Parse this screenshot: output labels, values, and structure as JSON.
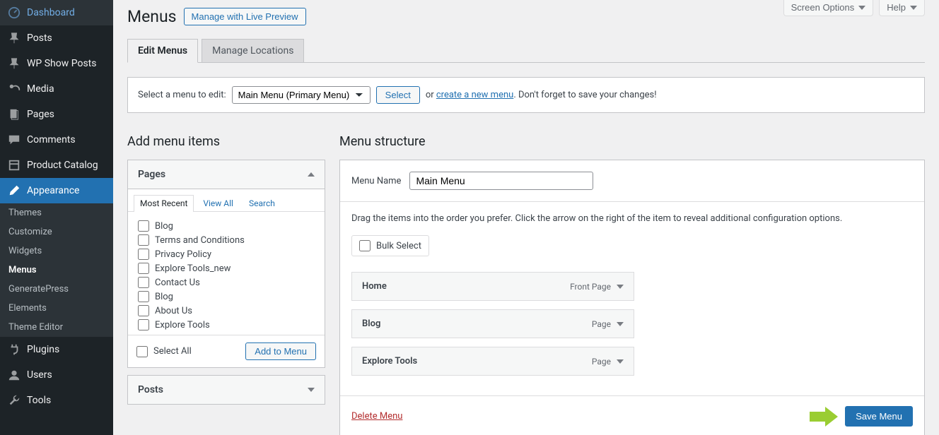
{
  "sidebar": {
    "items": [
      {
        "label": "Dashboard",
        "icon": "dashboard"
      },
      {
        "label": "Posts",
        "icon": "pin"
      },
      {
        "label": "WP Show Posts",
        "icon": "pin"
      },
      {
        "label": "Media",
        "icon": "media"
      },
      {
        "label": "Pages",
        "icon": "pages"
      },
      {
        "label": "Comments",
        "icon": "comment"
      },
      {
        "label": "Product Catalog",
        "icon": "catalog"
      },
      {
        "label": "Appearance",
        "icon": "brush",
        "active": true
      },
      {
        "label": "Plugins",
        "icon": "plugin"
      },
      {
        "label": "Users",
        "icon": "user"
      },
      {
        "label": "Tools",
        "icon": "wrench"
      }
    ],
    "submenu": [
      "Themes",
      "Customize",
      "Widgets",
      "Menus",
      "GeneratePress",
      "Elements",
      "Theme Editor"
    ],
    "submenu_current": "Menus"
  },
  "top": {
    "screen_options": "Screen Options",
    "help": "Help"
  },
  "title": "Menus",
  "live_preview": "Manage with Live Preview",
  "tabs": [
    {
      "label": "Edit Menus",
      "active": true
    },
    {
      "label": "Manage Locations",
      "active": false
    }
  ],
  "select_bar": {
    "label": "Select a menu to edit:",
    "value": "Main Menu (Primary Menu)",
    "btn": "Select",
    "or": "or",
    "link": "create a new menu",
    "tail": ". Don't forget to save your changes!"
  },
  "left": {
    "heading": "Add menu items",
    "accordion_pages": "Pages",
    "sub_tabs": [
      "Most Recent",
      "View All",
      "Search"
    ],
    "pages": [
      "Blog",
      "Terms and Conditions",
      "Privacy Policy",
      "Explore Tools_new",
      "Contact Us",
      "Blog",
      "About Us",
      "Explore Tools"
    ],
    "select_all": "Select All",
    "add": "Add to Menu",
    "accordion_posts": "Posts"
  },
  "right": {
    "heading": "Menu structure",
    "name_label": "Menu Name",
    "name_value": "Main Menu",
    "hint": "Drag the items into the order you prefer. Click the arrow on the right of the item to reveal additional configuration options.",
    "bulk": "Bulk Select",
    "items": [
      {
        "title": "Home",
        "type": "Front Page"
      },
      {
        "title": "Blog",
        "type": "Page"
      },
      {
        "title": "Explore Tools",
        "type": "Page"
      }
    ],
    "delete": "Delete Menu",
    "save": "Save Menu"
  }
}
